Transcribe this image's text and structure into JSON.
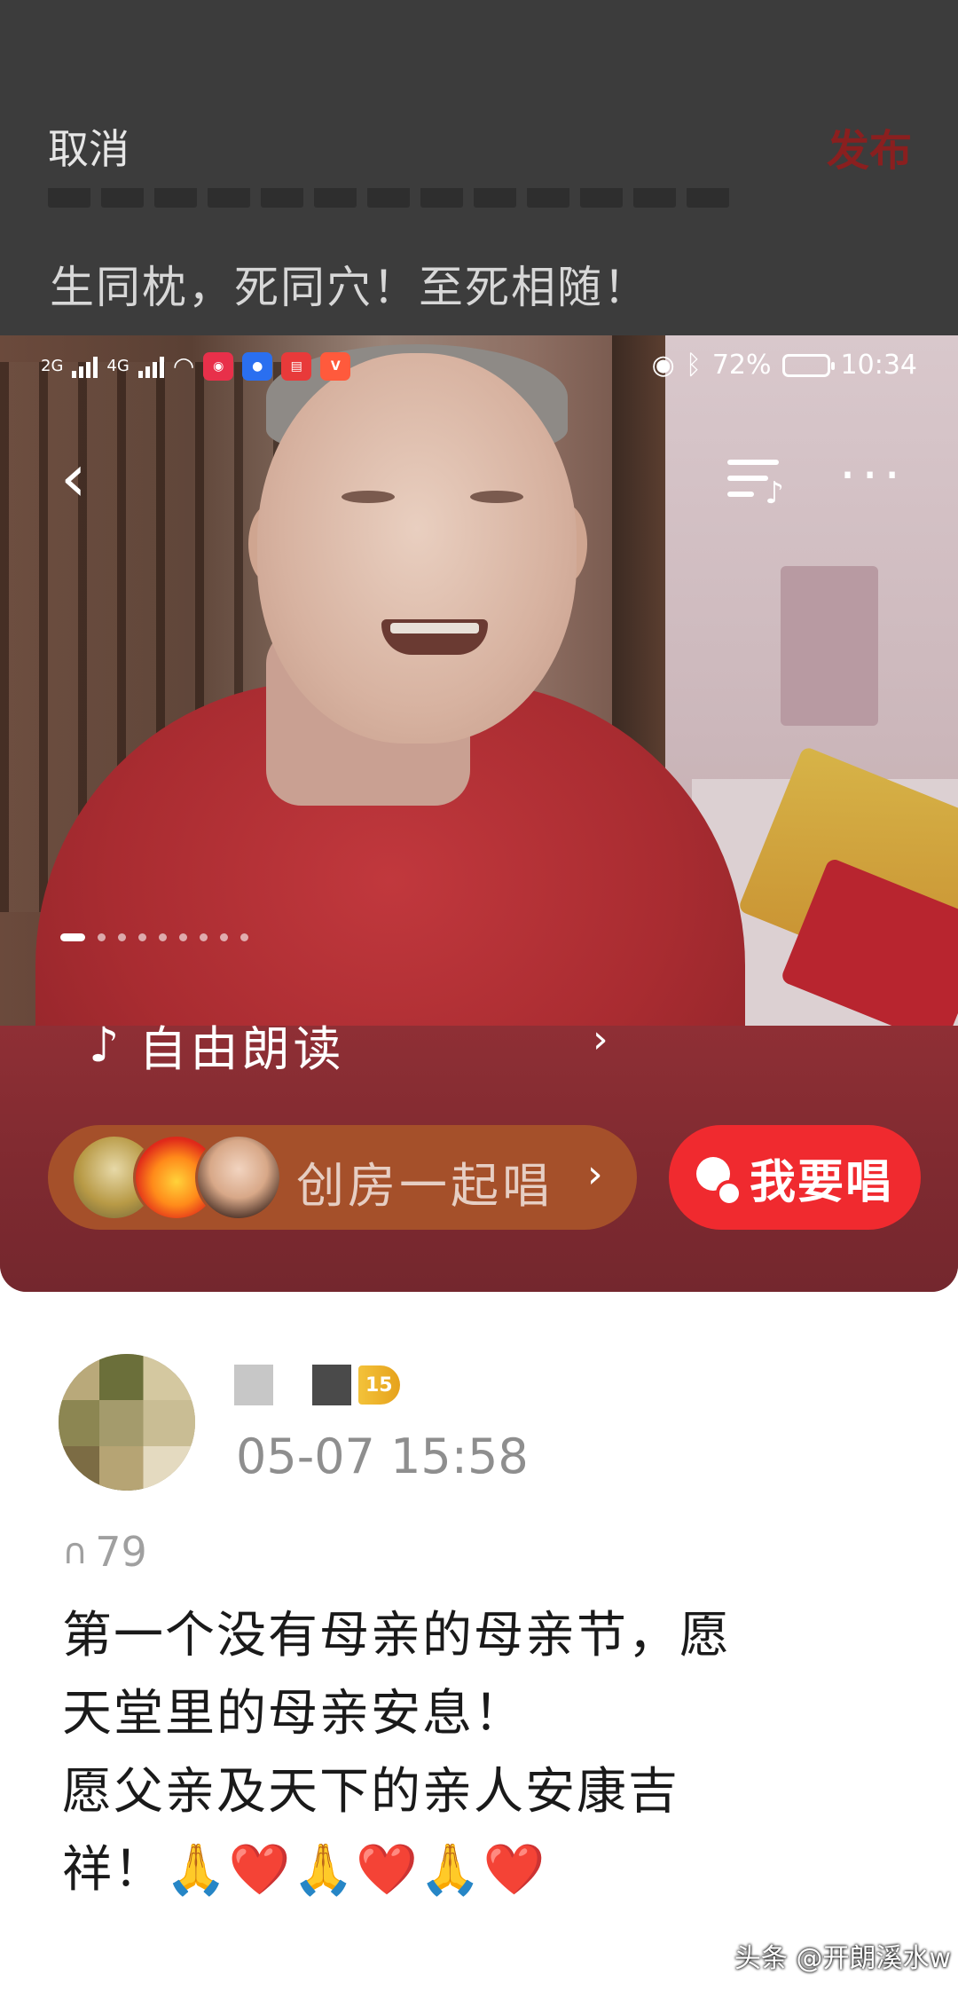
{
  "editor": {
    "cancel_label": "取消",
    "publish_label": "发布",
    "quote_text": "生同枕，死同穴！至死相随！"
  },
  "status_bar": {
    "net1": "2G",
    "net2": "4G",
    "battery": "72%",
    "time": "10:34"
  },
  "media": {
    "back_icon": "back-chevron-icon",
    "playlist_icon": "playlist-icon",
    "more_icon": "more-icon",
    "slides_total": 9,
    "slide_active": 1,
    "read_label": "自由朗读",
    "room_label": "创房一起唱",
    "sing_label": "我要唱",
    "colors": {
      "sing_button": "#f02a2f",
      "room_pill": "#a5502a",
      "band": "#8f2f35"
    }
  },
  "post": {
    "level": "15",
    "time": "05-07 15:58",
    "listen_count": "79",
    "body_lines": [
      "第一个没有母亲的母亲节，愿",
      "天堂里的母亲安息！",
      "愿父亲及天下的亲人安康吉",
      "祥！🙏❤️🙏❤️🙏❤️"
    ]
  },
  "watermark": "头条 @开朗溪水w"
}
